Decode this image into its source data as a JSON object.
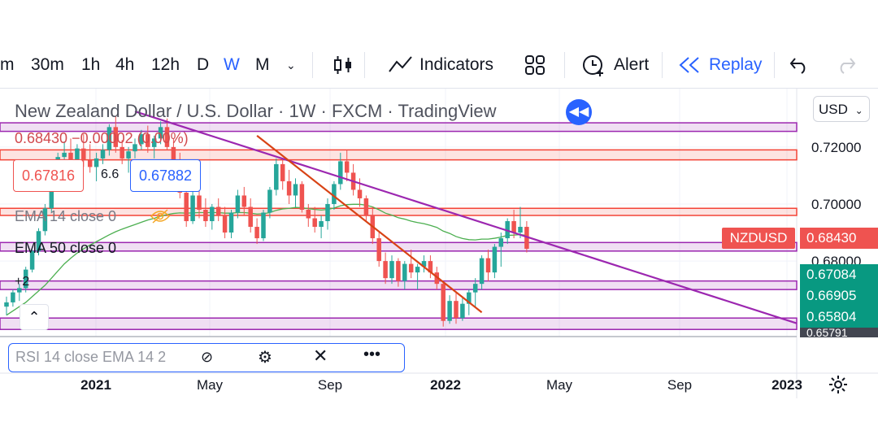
{
  "toolbar": {
    "intervals": [
      "m",
      "30m",
      "1h",
      "4h",
      "12h",
      "D",
      "W",
      "M"
    ],
    "active_interval": "W",
    "indicators_label": "Indicators",
    "alert_label": "Alert",
    "replay_label": "Replay"
  },
  "legend": {
    "title": "New Zealand Dollar / U.S. Dollar · 1W · FXCM · TradingView",
    "last_line": "0.68430 −0.00002 (0.00%)",
    "bid": "0.67816",
    "spread": "6.6",
    "ask": "0.67882",
    "ema14": "EMA 14 close 0",
    "ema50": "EMA 50 close 0",
    "marker": "+2"
  },
  "rsi_panel": {
    "label": "RSI 14 close EMA 14 2"
  },
  "currency_selector": "USD",
  "symbol_badge": "NZDUSD",
  "colors": {
    "up": "#26a69a",
    "down": "#ef5350",
    "accent": "#2962ff",
    "zone_purple": "#9c27b0",
    "zone_red": "#f44336",
    "green_label": "#089981"
  },
  "chart_data": {
    "type": "candlestick",
    "title": "New Zealand Dollar / U.S. Dollar · 1W · FXCM · TradingView",
    "symbol": "NZDUSD",
    "timeframe": "1W",
    "y_axis": {
      "ticks": [
        "0.72000",
        "0.70000",
        "0.68000"
      ],
      "range": [
        0.6535,
        0.7405
      ],
      "price_labels": [
        {
          "value": "0.68430",
          "style": "red"
        },
        {
          "value": "0.67084",
          "style": "green"
        },
        {
          "value": "0.66905",
          "style": "green"
        },
        {
          "value": "0.65804",
          "style": "green"
        },
        {
          "value": "0.65791",
          "style": "dark"
        }
      ]
    },
    "x_axis": {
      "ticks": [
        "2021",
        "May",
        "Sep",
        "2022",
        "May",
        "Sep",
        "2023"
      ]
    },
    "candles": [
      [
        0.664,
        0.6675,
        0.661,
        0.6655
      ],
      [
        0.6655,
        0.67,
        0.664,
        0.669
      ],
      [
        0.669,
        0.672,
        0.666,
        0.6705
      ],
      [
        0.6705,
        0.678,
        0.669,
        0.677
      ],
      [
        0.677,
        0.684,
        0.676,
        0.6835
      ],
      [
        0.6835,
        0.6915,
        0.682,
        0.6905
      ],
      [
        0.6905,
        0.7,
        0.689,
        0.6985
      ],
      [
        0.6985,
        0.708,
        0.697,
        0.707
      ],
      [
        0.707,
        0.718,
        0.706,
        0.7165
      ],
      [
        0.7165,
        0.722,
        0.712,
        0.718
      ],
      [
        0.718,
        0.723,
        0.712,
        0.715
      ],
      [
        0.715,
        0.721,
        0.714,
        0.7195
      ],
      [
        0.7195,
        0.7245,
        0.713,
        0.7155
      ],
      [
        0.7155,
        0.721,
        0.711,
        0.713
      ],
      [
        0.713,
        0.718,
        0.708,
        0.716
      ],
      [
        0.716,
        0.721,
        0.714,
        0.719
      ],
      [
        0.719,
        0.728,
        0.717,
        0.727
      ],
      [
        0.727,
        0.731,
        0.718,
        0.72
      ],
      [
        0.72,
        0.7225,
        0.714,
        0.716
      ],
      [
        0.716,
        0.72,
        0.711,
        0.7185
      ],
      [
        0.7185,
        0.723,
        0.716,
        0.721
      ],
      [
        0.721,
        0.726,
        0.719,
        0.7245
      ],
      [
        0.7245,
        0.7275,
        0.718,
        0.72
      ],
      [
        0.72,
        0.724,
        0.716,
        0.723
      ],
      [
        0.723,
        0.729,
        0.721,
        0.727
      ],
      [
        0.727,
        0.73,
        0.719,
        0.72
      ],
      [
        0.72,
        0.723,
        0.714,
        0.715
      ],
      [
        0.715,
        0.718,
        0.702,
        0.704
      ],
      [
        0.704,
        0.711,
        0.692,
        0.694
      ],
      [
        0.694,
        0.705,
        0.693,
        0.703
      ],
      [
        0.703,
        0.708,
        0.695,
        0.698
      ],
      [
        0.698,
        0.702,
        0.692,
        0.694
      ],
      [
        0.694,
        0.7,
        0.691,
        0.699
      ],
      [
        0.699,
        0.702,
        0.694,
        0.696
      ],
      [
        0.696,
        0.699,
        0.688,
        0.69
      ],
      [
        0.69,
        0.698,
        0.688,
        0.697
      ],
      [
        0.697,
        0.705,
        0.695,
        0.703
      ],
      [
        0.703,
        0.706,
        0.696,
        0.699
      ],
      [
        0.699,
        0.702,
        0.69,
        0.692
      ],
      [
        0.692,
        0.695,
        0.686,
        0.688
      ],
      [
        0.688,
        0.698,
        0.687,
        0.697
      ],
      [
        0.697,
        0.706,
        0.695,
        0.705
      ],
      [
        0.705,
        0.716,
        0.703,
        0.714
      ],
      [
        0.714,
        0.716,
        0.705,
        0.708
      ],
      [
        0.708,
        0.712,
        0.7,
        0.703
      ],
      [
        0.703,
        0.709,
        0.699,
        0.707
      ],
      [
        0.707,
        0.708,
        0.697,
        0.698
      ],
      [
        0.698,
        0.7,
        0.692,
        0.695
      ],
      [
        0.695,
        0.699,
        0.69,
        0.692
      ],
      [
        0.692,
        0.696,
        0.688,
        0.694
      ],
      [
        0.694,
        0.702,
        0.691,
        0.7
      ],
      [
        0.7,
        0.708,
        0.698,
        0.707
      ],
      [
        0.707,
        0.718,
        0.705,
        0.715
      ],
      [
        0.715,
        0.719,
        0.708,
        0.711
      ],
      [
        0.711,
        0.714,
        0.703,
        0.705
      ],
      [
        0.705,
        0.709,
        0.699,
        0.702
      ],
      [
        0.702,
        0.703,
        0.694,
        0.696
      ],
      [
        0.696,
        0.699,
        0.686,
        0.688
      ],
      [
        0.688,
        0.69,
        0.678,
        0.68
      ],
      [
        0.68,
        0.683,
        0.672,
        0.674
      ],
      [
        0.674,
        0.682,
        0.672,
        0.68
      ],
      [
        0.68,
        0.681,
        0.671,
        0.673
      ],
      [
        0.673,
        0.68,
        0.67,
        0.679
      ],
      [
        0.679,
        0.684,
        0.674,
        0.676
      ],
      [
        0.676,
        0.679,
        0.67,
        0.678
      ],
      [
        0.678,
        0.682,
        0.676,
        0.68
      ],
      [
        0.68,
        0.682,
        0.674,
        0.676
      ],
      [
        0.676,
        0.678,
        0.67,
        0.672
      ],
      [
        0.672,
        0.673,
        0.657,
        0.659
      ],
      [
        0.659,
        0.668,
        0.658,
        0.666
      ],
      [
        0.666,
        0.669,
        0.658,
        0.66
      ],
      [
        0.66,
        0.667,
        0.659,
        0.665
      ],
      [
        0.665,
        0.67,
        0.661,
        0.669
      ],
      [
        0.669,
        0.674,
        0.664,
        0.672
      ],
      [
        0.672,
        0.682,
        0.67,
        0.681
      ],
      [
        0.681,
        0.684,
        0.673,
        0.676
      ],
      [
        0.676,
        0.686,
        0.674,
        0.685
      ],
      [
        0.685,
        0.69,
        0.678,
        0.688
      ],
      [
        0.688,
        0.695,
        0.686,
        0.694
      ],
      [
        0.694,
        0.698,
        0.688,
        0.69
      ],
      [
        0.69,
        0.699,
        0.688,
        0.692
      ],
      [
        0.692,
        0.694,
        0.683,
        0.6843
      ]
    ],
    "ema": [
      0.661,
      0.6625,
      0.664,
      0.6655,
      0.6675,
      0.6695,
      0.6715,
      0.674,
      0.6765,
      0.679,
      0.681,
      0.6828,
      0.6843,
      0.6856,
      0.6868,
      0.688,
      0.6892,
      0.6903,
      0.6912,
      0.692,
      0.6928,
      0.6936,
      0.6944,
      0.695,
      0.6957,
      0.6963,
      0.6967,
      0.6969,
      0.6968,
      0.6969,
      0.697,
      0.697,
      0.697,
      0.697,
      0.6968,
      0.6968,
      0.697,
      0.697,
      0.6968,
      0.6965,
      0.6966,
      0.697,
      0.6978,
      0.6983,
      0.6985,
      0.6988,
      0.6987,
      0.6984,
      0.6981,
      0.6979,
      0.6981,
      0.6986,
      0.6994,
      0.6998,
      0.6999,
      0.6999,
      0.6996,
      0.699,
      0.698,
      0.6968,
      0.6961,
      0.6952,
      0.6947,
      0.694,
      0.6935,
      0.6931,
      0.6925,
      0.6918,
      0.6905,
      0.6897,
      0.6886,
      0.6879,
      0.6875,
      0.6874,
      0.6877,
      0.6877,
      0.688,
      0.6884,
      0.689,
      0.6891,
      0.6893,
      0.689
    ],
    "zones": [
      {
        "from": 0.7255,
        "to": 0.7285,
        "color": "purple"
      },
      {
        "from": 0.7155,
        "to": 0.719,
        "color": "red"
      },
      {
        "from": 0.696,
        "to": 0.6985,
        "color": "red"
      },
      {
        "from": 0.6835,
        "to": 0.6865,
        "color": "purple"
      },
      {
        "from": 0.67,
        "to": 0.673,
        "color": "purple"
      },
      {
        "from": 0.656,
        "to": 0.66,
        "color": "purple"
      }
    ],
    "trendlines": [
      {
        "color": "purple",
        "from": [
          20,
          0.7325
        ],
        "to": [
          90,
          0.682
        ]
      },
      {
        "color": "red",
        "from": [
          39,
          0.724
        ],
        "to": [
          74,
          0.662
        ]
      }
    ]
  }
}
